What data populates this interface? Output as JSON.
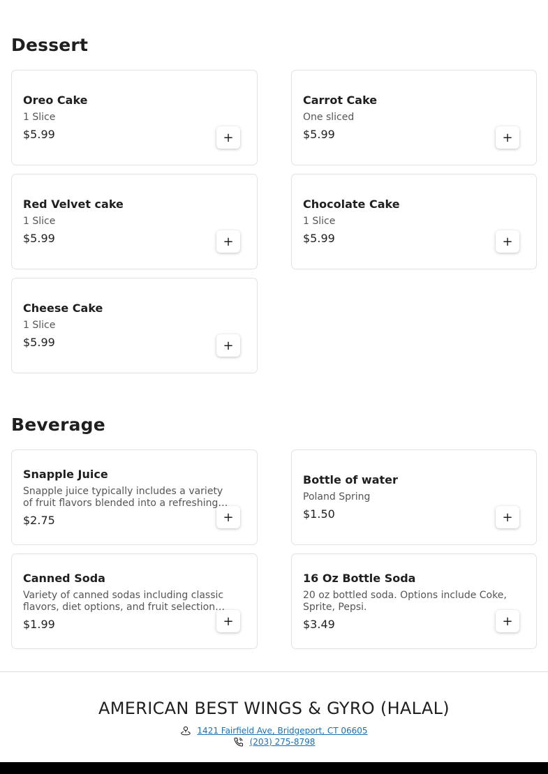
{
  "sections": [
    {
      "title": "Dessert",
      "items": [
        {
          "name": "Oreo Cake",
          "desc": "1 Slice",
          "price": "$5.99"
        },
        {
          "name": "Carrot Cake",
          "desc": "One sliced",
          "price": "$5.99"
        },
        {
          "name": "Red Velvet cake",
          "desc": "1 Slice",
          "price": "$5.99"
        },
        {
          "name": "Chocolate Cake",
          "desc": "1 Slice",
          "price": "$5.99"
        },
        {
          "name": "Cheese Cake",
          "desc": "1 Slice",
          "price": "$5.99"
        }
      ]
    },
    {
      "title": "Beverage",
      "items": [
        {
          "name": "Snapple Juice",
          "desc": "Snapple juice typically includes a variety of fruit flavors blended into a refreshing…",
          "price": "$2.75"
        },
        {
          "name": "Bottle of water",
          "desc": "Poland Spring",
          "price": "$1.50"
        },
        {
          "name": "Canned Soda",
          "desc": "Variety of canned sodas including classic flavors, diet options, and fruit selections lik…",
          "price": "$1.99"
        },
        {
          "name": "16 Oz Bottle Soda",
          "desc": "20 oz bottled soda. Options include Coke, Sprite, Pepsi.",
          "price": "$3.49"
        }
      ]
    }
  ],
  "add_label": "+",
  "icons": {
    "add": "plus-icon",
    "address": "map-pin-icon",
    "phone": "phone-icon"
  },
  "footer": {
    "restaurant_name": "AMERICAN BEST WINGS & GYRO (HALAL)",
    "address": "1421 Fairfield Ave, Bridgeport, CT 06605",
    "phone": "(203) 275-8798"
  },
  "colors": {
    "link": "#1a6fb5",
    "border": "#e2e2e2",
    "bottom_bar": "#000000"
  }
}
